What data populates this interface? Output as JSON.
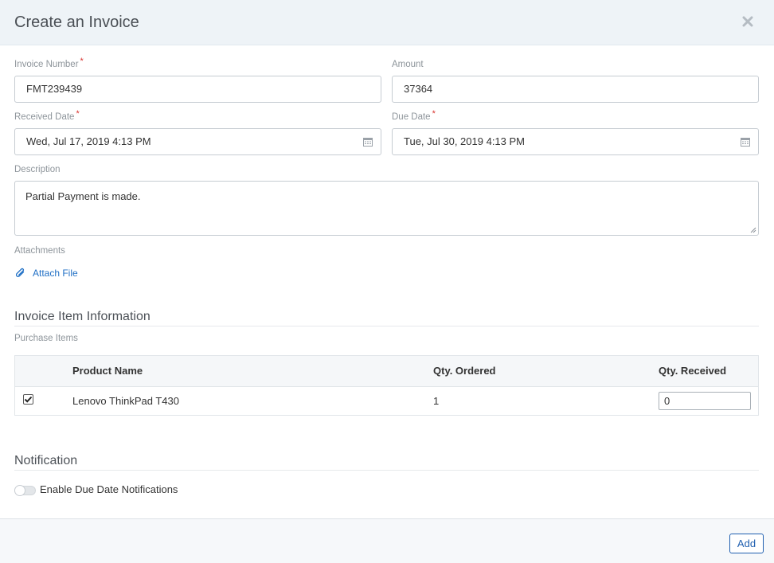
{
  "modal": {
    "title": "Create an Invoice",
    "close_icon": "close-icon"
  },
  "form": {
    "invoice_number": {
      "label": "Invoice Number",
      "required": "*",
      "value": "FMT239439"
    },
    "amount": {
      "label": "Amount",
      "value": "37364"
    },
    "received_date": {
      "label": "Received Date",
      "required": "*",
      "value": "Wed, Jul 17, 2019 4:13 PM"
    },
    "due_date": {
      "label": "Due Date",
      "required": "*",
      "value": "Tue, Jul 30, 2019 4:13 PM"
    },
    "description": {
      "label": "Description",
      "value": "Partial Payment is made."
    },
    "attachments": {
      "label": "Attachments",
      "link": "Attach File",
      "icon": "paperclip-icon"
    }
  },
  "invoice_items": {
    "section_title": "Invoice Item Information",
    "subtitle": "Purchase Items",
    "columns": [
      "Product Name",
      "Qty. Ordered",
      "Qty. Received"
    ],
    "rows": [
      {
        "checked": true,
        "product": "Lenovo ThinkPad T430",
        "ordered": "1",
        "received": "0"
      }
    ]
  },
  "notification": {
    "section_title": "Notification",
    "toggle_label": "Enable Due Date Notifications",
    "enabled": false
  },
  "footer": {
    "add_label": "Add"
  },
  "colors": {
    "header_bg": "#eef3f7",
    "link": "#1f6fc5",
    "required": "#d9332f",
    "primary_button": "#1f5fb0"
  }
}
